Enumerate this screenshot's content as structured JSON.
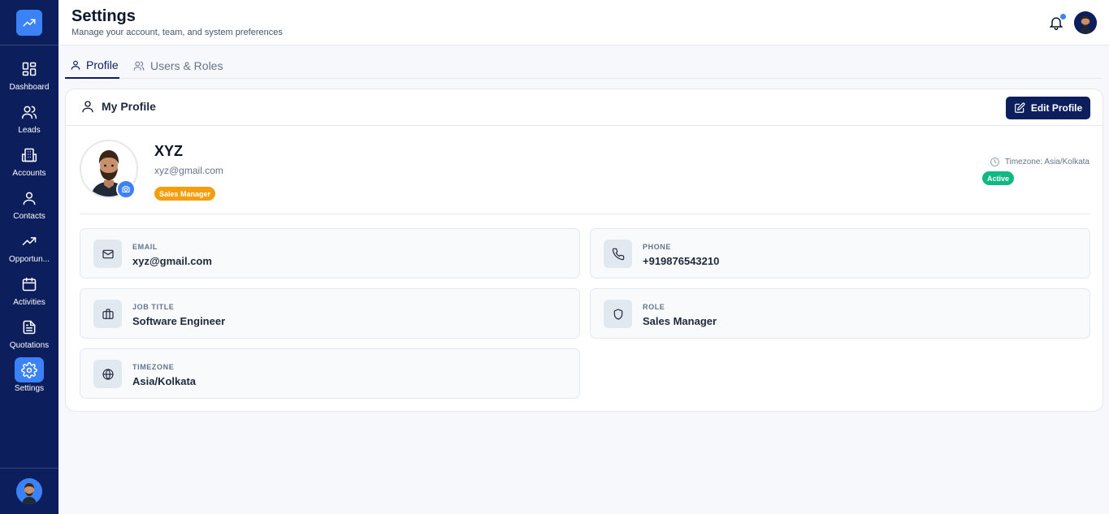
{
  "sidebar": {
    "logo_icon": "trending-up-icon",
    "items": [
      {
        "label": "Dashboard",
        "icon": "dashboard-icon"
      },
      {
        "label": "Leads",
        "icon": "users-icon"
      },
      {
        "label": "Accounts",
        "icon": "building-icon"
      },
      {
        "label": "Contacts",
        "icon": "user-icon"
      },
      {
        "label": "Opportun...",
        "icon": "trending-up-icon"
      },
      {
        "label": "Activities",
        "icon": "calendar-icon"
      },
      {
        "label": "Quotations",
        "icon": "document-icon"
      },
      {
        "label": "Settings",
        "icon": "gear-icon",
        "active": true
      }
    ]
  },
  "header": {
    "title": "Settings",
    "subtitle": "Manage your account, team, and system preferences"
  },
  "tabs": [
    {
      "label": "Profile",
      "icon": "user-icon",
      "active": true
    },
    {
      "label": "Users & Roles",
      "icon": "users-icon",
      "active": false
    }
  ],
  "profile": {
    "card_title": "My Profile",
    "edit_label": "Edit Profile",
    "name": "XYZ",
    "email": "xyz@gmail.com",
    "role_badge": "Sales Manager",
    "timezone_line": "Timezone: Asia/Kolkata",
    "status": "Active",
    "fields": [
      {
        "label": "EMAIL",
        "value": "xyz@gmail.com",
        "icon": "mail-icon"
      },
      {
        "label": "PHONE",
        "value": "+919876543210",
        "icon": "phone-icon"
      },
      {
        "label": "JOB TITLE",
        "value": "Software Engineer",
        "icon": "briefcase-icon"
      },
      {
        "label": "ROLE",
        "value": "Sales Manager",
        "icon": "shield-icon"
      },
      {
        "label": "TIMEZONE",
        "value": "Asia/Kolkata",
        "icon": "globe-icon"
      }
    ]
  },
  "colors": {
    "sidebar_bg": "#0c1f5c",
    "accent": "#3b82f6",
    "role_badge": "#f59e0b",
    "active_badge": "#10b981"
  }
}
